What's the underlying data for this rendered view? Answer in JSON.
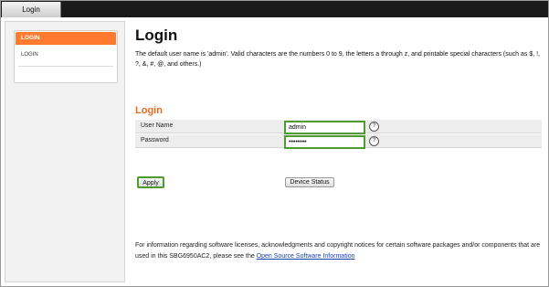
{
  "tab": {
    "label": "Login"
  },
  "sidebar": {
    "items": [
      {
        "label": "LOGIN",
        "active": true
      },
      {
        "label": "LOGIN",
        "active": false
      }
    ]
  },
  "main": {
    "title": "Login",
    "intro": "The default user name is 'admin'. Valid characters are the numbers 0 to 9, the letters a through z, and printable special characters (such as $, !, ?, &, #, @, and others.)",
    "section_title": "Login",
    "fields": {
      "username": {
        "label": "User Name",
        "value": "admin",
        "help": "?"
      },
      "password": {
        "label": "Password",
        "value": "••••••••",
        "help": "?"
      }
    },
    "buttons": {
      "apply": "Apply",
      "device_status": "Device Status"
    },
    "footer": {
      "text": "For information regarding software licenses, acknowledgments and copyright notices for certain software packages and/or components that are used in this SBG6950AC2, please see the ",
      "link": "Open Source Software Information"
    }
  },
  "colors": {
    "accent": "#ff7a2f",
    "section_title": "#e86a1f",
    "highlight": "#4f9b2f",
    "link": "#1a3fb0"
  }
}
